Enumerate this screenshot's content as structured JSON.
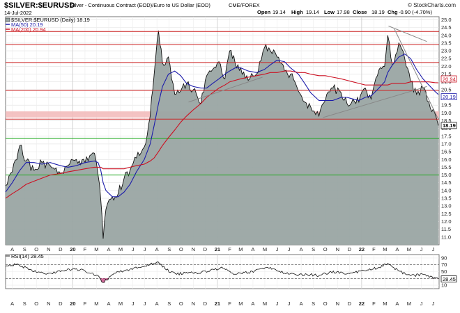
{
  "header": {
    "symbol": "$SILVER:$EURUSD",
    "description": "Silver - Continuous Contract (EOD)/Euro to US Dollar (EOD)",
    "exchange": "CME/FOREX",
    "date": "14-Jul-2022",
    "watermark": "© StockCharts.com",
    "ohlc": {
      "open_label": "Open",
      "open": "19.14",
      "high_label": "High",
      "high": "19.14",
      "low_label": "Low",
      "low": "17.98",
      "close_label": "Close",
      "close": "18.19",
      "chg_label": "Chg",
      "chg": "-0.90 (-4.70%)"
    }
  },
  "legend": {
    "main": "$SILVER:$EURUSD (Daily) 18.19",
    "ma50": "MA(50) 20.19",
    "ma200": "MA(200) 20.94",
    "rsi": "RSI(14) 28.45"
  },
  "badges": {
    "ma200": "20.94",
    "ma50": "20.19",
    "last": "18.19",
    "rsi": "28.45"
  },
  "colors": {
    "area_fill": "#9aa5a3",
    "price_line": "#111111",
    "ma50": "#1c1caa",
    "ma200": "#cc1122",
    "resistance": "#cc2222",
    "support": "#22aa22",
    "zone": "#f2b9b9",
    "trendline": "#888888",
    "oversold": "#c1397a"
  },
  "chart_data": [
    {
      "type": "area",
      "title": "$SILVER:$EURUSD (Daily) 18.19",
      "y_scale": "linear",
      "ylim": [
        10.5,
        25.2
      ],
      "yticks": [
        11.0,
        11.5,
        12.0,
        12.5,
        13.0,
        13.5,
        14.0,
        14.5,
        15.0,
        15.5,
        16.0,
        16.5,
        17.0,
        17.5,
        18.0,
        18.5,
        19.0,
        19.5,
        20.0,
        20.5,
        21.0,
        21.5,
        22.0,
        22.5,
        23.0,
        23.5,
        24.0,
        24.5,
        25.0
      ],
      "xtick_labels": [
        "A",
        "S",
        "O",
        "N",
        "D",
        "20",
        "F",
        "M",
        "A",
        "M",
        "J",
        "J",
        "A",
        "S",
        "O",
        "N",
        "D",
        "21",
        "F",
        "M",
        "A",
        "M",
        "J",
        "J",
        "A",
        "S",
        "O",
        "N",
        "D",
        "22",
        "F",
        "M",
        "A",
        "M",
        "J",
        "J"
      ],
      "x": [
        "2019-07-15",
        "2019-08-01",
        "2019-08-20",
        "2019-09-05",
        "2019-09-25",
        "2019-10-15",
        "2019-11-05",
        "2019-12-01",
        "2019-12-20",
        "2020-01-10",
        "2020-02-01",
        "2020-02-25",
        "2020-03-05",
        "2020-03-12",
        "2020-03-18",
        "2020-03-25",
        "2020-04-10",
        "2020-04-25",
        "2020-05-10",
        "2020-05-25",
        "2020-06-10",
        "2020-06-30",
        "2020-07-15",
        "2020-07-25",
        "2020-08-05",
        "2020-08-15",
        "2020-08-30",
        "2020-09-15",
        "2020-09-30",
        "2020-10-15",
        "2020-11-01",
        "2020-11-20",
        "2020-12-05",
        "2020-12-20",
        "2021-01-05",
        "2021-01-20",
        "2021-02-01",
        "2021-02-15",
        "2021-03-01",
        "2021-03-20",
        "2021-04-10",
        "2021-04-30",
        "2021-05-15",
        "2021-06-01",
        "2021-06-20",
        "2021-07-05",
        "2021-07-25",
        "2021-08-10",
        "2021-08-25",
        "2021-09-15",
        "2021-10-01",
        "2021-10-20",
        "2021-11-10",
        "2021-11-25",
        "2021-12-10",
        "2021-12-25",
        "2022-01-10",
        "2022-01-25",
        "2022-02-10",
        "2022-02-28",
        "2022-03-08",
        "2022-03-20",
        "2022-04-05",
        "2022-04-20",
        "2022-05-05",
        "2022-05-20",
        "2022-06-05",
        "2022-06-20",
        "2022-07-05",
        "2022-07-14"
      ],
      "series": [
        {
          "name": "$SILVER:$EURUSD",
          "values": [
            14.3,
            15.2,
            16.9,
            15.9,
            15.3,
            15.8,
            15.6,
            15.1,
            15.6,
            16.0,
            15.8,
            16.4,
            15.0,
            13.4,
            10.9,
            12.8,
            13.6,
            13.8,
            14.8,
            15.3,
            16.1,
            16.8,
            18.8,
            21.5,
            24.3,
            22.2,
            22.6,
            20.2,
            20.4,
            20.9,
            20.5,
            19.6,
            21.4,
            21.8,
            22.3,
            21.2,
            23.0,
            22.2,
            21.9,
            21.1,
            21.5,
            23.2,
            23.0,
            22.6,
            21.7,
            21.5,
            20.4,
            19.7,
            19.4,
            18.8,
            19.8,
            20.6,
            20.3,
            19.6,
            19.9,
            19.7,
            20.6,
            19.9,
            21.4,
            22.0,
            24.0,
            22.1,
            23.5,
            22.5,
            21.0,
            20.2,
            20.6,
            19.7,
            19.0,
            18.19
          ]
        },
        {
          "name": "MA(50)",
          "values": [
            13.9,
            14.5,
            15.3,
            15.8,
            15.8,
            15.7,
            15.8,
            15.6,
            15.5,
            15.6,
            15.8,
            15.9,
            15.8,
            15.3,
            14.5,
            14.0,
            13.6,
            13.6,
            13.9,
            14.4,
            15.2,
            16.0,
            17.0,
            18.2,
            19.6,
            20.7,
            21.5,
            21.7,
            21.4,
            20.9,
            20.7,
            20.6,
            20.6,
            20.9,
            21.2,
            21.5,
            21.7,
            21.9,
            21.9,
            21.7,
            21.6,
            21.8,
            22.1,
            22.4,
            22.3,
            21.9,
            21.5,
            20.9,
            20.3,
            19.8,
            19.8,
            19.8,
            20.0,
            20.0,
            19.9,
            19.8,
            20.0,
            20.1,
            20.5,
            21.0,
            21.6,
            22.1,
            22.6,
            22.8,
            22.5,
            21.8,
            21.2,
            20.8,
            20.4,
            20.19
          ]
        },
        {
          "name": "MA(200)",
          "values": [
            13.5,
            13.8,
            14.1,
            14.4,
            14.6,
            14.8,
            15.0,
            15.1,
            15.2,
            15.3,
            15.4,
            15.5,
            15.5,
            15.5,
            15.4,
            15.4,
            15.4,
            15.4,
            15.4,
            15.5,
            15.6,
            15.7,
            15.9,
            16.1,
            16.5,
            16.9,
            17.4,
            17.9,
            18.4,
            18.8,
            19.2,
            19.6,
            20.0,
            20.3,
            20.6,
            20.8,
            21.0,
            21.1,
            21.2,
            21.3,
            21.4,
            21.5,
            21.6,
            21.6,
            21.7,
            21.7,
            21.6,
            21.6,
            21.5,
            21.4,
            21.4,
            21.3,
            21.2,
            21.1,
            21.0,
            20.9,
            20.8,
            20.8,
            20.8,
            20.8,
            20.8,
            20.9,
            20.9,
            20.9,
            21.0,
            21.0,
            21.0,
            21.0,
            20.95,
            20.94
          ]
        }
      ],
      "horizontal_lines": [
        {
          "y": 24.25,
          "color": "red"
        },
        {
          "y": 23.4,
          "color": "red"
        },
        {
          "y": 22.25,
          "color": "red"
        },
        {
          "y": 20.45,
          "color": "red"
        },
        {
          "y": 18.6,
          "color": "red"
        },
        {
          "y": 17.35,
          "color": "green"
        },
        {
          "y": 15.0,
          "color": "green"
        }
      ],
      "zone": {
        "from": 18.7,
        "to": 19.1
      },
      "trendlines": [
        {
          "from": [
            "2020-10-20",
            19.7
          ],
          "to": [
            "2021-04-25",
            21.3
          ]
        },
        {
          "from": [
            "2021-09-25",
            18.7
          ],
          "to": [
            "2022-06-15",
            20.7
          ]
        },
        {
          "from": [
            "2022-03-10",
            24.6
          ],
          "to": [
            "2022-06-15",
            23.6
          ]
        },
        {
          "from": [
            "2022-03-25",
            24.4
          ],
          "to": [
            "2022-07-14",
            18.6
          ]
        }
      ]
    },
    {
      "type": "line",
      "title": "RSI(14) 28.45",
      "ylim": [
        0,
        100
      ],
      "yticks": [
        10,
        30,
        50,
        70,
        90
      ],
      "reference_lines": [
        30,
        70
      ],
      "x": [
        "2019-07-15",
        "2019-08-10",
        "2019-09-05",
        "2019-10-01",
        "2019-11-01",
        "2019-12-01",
        "2020-01-01",
        "2020-02-01",
        "2020-03-01",
        "2020-03-18",
        "2020-04-15",
        "2020-05-15",
        "2020-06-15",
        "2020-07-15",
        "2020-08-05",
        "2020-08-25",
        "2020-09-20",
        "2020-10-15",
        "2020-11-15",
        "2020-12-15",
        "2021-01-15",
        "2021-02-05",
        "2021-03-05",
        "2021-04-05",
        "2021-05-05",
        "2021-05-25",
        "2021-06-20",
        "2021-07-20",
        "2021-08-15",
        "2021-09-15",
        "2021-10-15",
        "2021-11-15",
        "2021-12-15",
        "2022-01-15",
        "2022-02-15",
        "2022-03-08",
        "2022-04-05",
        "2022-05-05",
        "2022-06-05",
        "2022-07-14"
      ],
      "series": [
        {
          "name": "RSI(14)",
          "values": [
            66,
            70,
            62,
            48,
            45,
            50,
            58,
            52,
            40,
            18,
            45,
            55,
            62,
            72,
            78,
            55,
            42,
            48,
            45,
            55,
            60,
            46,
            44,
            52,
            62,
            58,
            45,
            40,
            42,
            38,
            50,
            46,
            48,
            55,
            62,
            74,
            52,
            38,
            42,
            28.45
          ]
        }
      ]
    }
  ]
}
